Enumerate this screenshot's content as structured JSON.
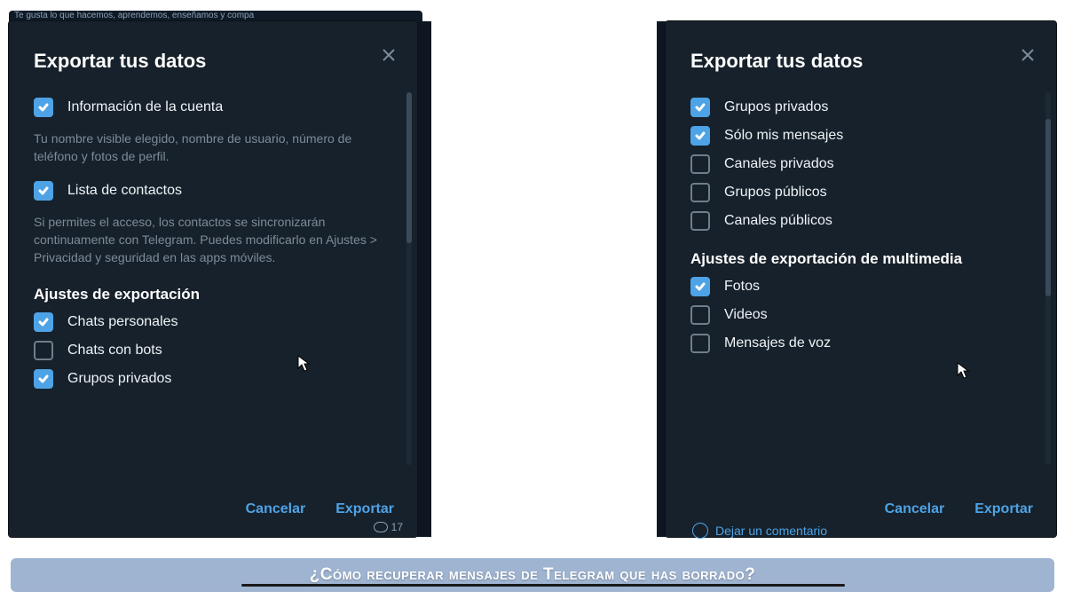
{
  "bg_strip": "Te gusta lo que hacemos, aprendemos, enseñamos y compa",
  "left": {
    "title": "Exportar tus datos",
    "items": [
      {
        "checked": true,
        "label": "Información de la cuenta"
      },
      {
        "checked": true,
        "label": "Lista de contactos"
      }
    ],
    "desc1": "Tu nombre visible elegido, nombre de usuario, número de teléfono y fotos de perfil.",
    "desc2": "Si permites el acceso, los contactos se sincronizarán continuamente con Telegram. Puedes modificarlo en Ajustes > Privacidad y seguridad en las apps móviles.",
    "section": "Ajustes de exportación",
    "export_items": [
      {
        "checked": true,
        "label": "Chats personales"
      },
      {
        "checked": false,
        "label": "Chats con bots"
      },
      {
        "checked": true,
        "label": "Grupos privados"
      }
    ],
    "cancel": "Cancelar",
    "export": "Exportar",
    "views": "17"
  },
  "right": {
    "title": "Exportar tus datos",
    "top_items": [
      {
        "checked": true,
        "label": "Grupos privados"
      }
    ],
    "sub_item": {
      "checked": true,
      "label": "Sólo mis mensajes"
    },
    "mid_items": [
      {
        "checked": false,
        "label": "Canales privados"
      },
      {
        "checked": false,
        "label": "Grupos públicos"
      },
      {
        "checked": false,
        "label": "Canales públicos"
      }
    ],
    "section": "Ajustes de exportación de multimedia",
    "media_items": [
      {
        "checked": true,
        "label": "Fotos"
      },
      {
        "checked": false,
        "label": "Videos"
      },
      {
        "checked": false,
        "label": "Mensajes de voz"
      }
    ],
    "cancel": "Cancelar",
    "export": "Exportar",
    "comment": "Dejar un comentario"
  },
  "caption": "¿Cómo recuperar mensajes de Telegram que has borrado?"
}
